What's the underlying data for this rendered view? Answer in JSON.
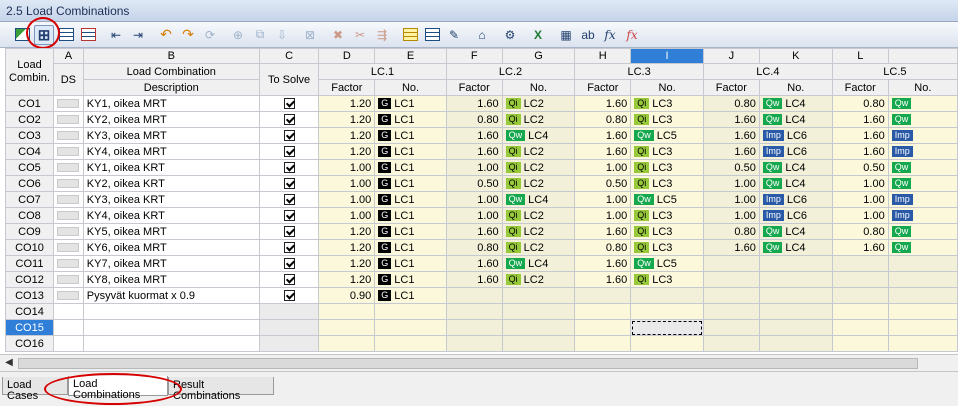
{
  "window": {
    "title": "2.5 Load Combinations"
  },
  "colletters": [
    "A",
    "B",
    "C",
    "D",
    "E",
    "F",
    "G",
    "H",
    "I",
    "J",
    "K",
    "L"
  ],
  "headers": {
    "load_combin_1": "Load",
    "load_combin_2": "Combin.",
    "ds": "DS",
    "lc_label": "Load Combination",
    "description": "Description",
    "to_solve": "To Solve",
    "factor": "Factor",
    "no": "No.",
    "groups": [
      "LC.1",
      "LC.2",
      "LC.3",
      "LC.4",
      "LC.5"
    ]
  },
  "rows": [
    {
      "id": "CO1",
      "desc": "KY1, oikea MRT",
      "solve": true,
      "lc": [
        {
          "f": "1.20",
          "t": "G",
          "n": "LC1"
        },
        {
          "f": "1.60",
          "t": "Qi",
          "n": "LC2"
        },
        {
          "f": "1.60",
          "t": "Qi",
          "n": "LC3"
        },
        {
          "f": "0.80",
          "t": "Qw",
          "n": "LC4"
        },
        {
          "f": "0.80",
          "t": "Qw",
          "n": ""
        }
      ]
    },
    {
      "id": "CO2",
      "desc": "KY2, oikea MRT",
      "solve": true,
      "lc": [
        {
          "f": "1.20",
          "t": "G",
          "n": "LC1"
        },
        {
          "f": "0.80",
          "t": "Qi",
          "n": "LC2"
        },
        {
          "f": "0.80",
          "t": "Qi",
          "n": "LC3"
        },
        {
          "f": "1.60",
          "t": "Qw",
          "n": "LC4"
        },
        {
          "f": "1.60",
          "t": "Qw",
          "n": ""
        }
      ]
    },
    {
      "id": "CO3",
      "desc": "KY3, oikea MRT",
      "solve": true,
      "lc": [
        {
          "f": "1.20",
          "t": "G",
          "n": "LC1"
        },
        {
          "f": "1.60",
          "t": "Qw",
          "n": "LC4"
        },
        {
          "f": "1.60",
          "t": "Qw",
          "n": "LC5"
        },
        {
          "f": "1.60",
          "t": "Imp",
          "n": "LC6"
        },
        {
          "f": "1.60",
          "t": "Imp",
          "n": ""
        }
      ]
    },
    {
      "id": "CO4",
      "desc": "KY4, oikea MRT",
      "solve": true,
      "lc": [
        {
          "f": "1.20",
          "t": "G",
          "n": "LC1"
        },
        {
          "f": "1.60",
          "t": "Qi",
          "n": "LC2"
        },
        {
          "f": "1.60",
          "t": "Qi",
          "n": "LC3"
        },
        {
          "f": "1.60",
          "t": "Imp",
          "n": "LC6"
        },
        {
          "f": "1.60",
          "t": "Imp",
          "n": ""
        }
      ]
    },
    {
      "id": "CO5",
      "desc": "KY1, oikea KRT",
      "solve": true,
      "lc": [
        {
          "f": "1.00",
          "t": "G",
          "n": "LC1"
        },
        {
          "f": "1.00",
          "t": "Qi",
          "n": "LC2"
        },
        {
          "f": "1.00",
          "t": "Qi",
          "n": "LC3"
        },
        {
          "f": "0.50",
          "t": "Qw",
          "n": "LC4"
        },
        {
          "f": "0.50",
          "t": "Qw",
          "n": ""
        }
      ]
    },
    {
      "id": "CO6",
      "desc": "KY2, oikea KRT",
      "solve": true,
      "lc": [
        {
          "f": "1.00",
          "t": "G",
          "n": "LC1"
        },
        {
          "f": "0.50",
          "t": "Qi",
          "n": "LC2"
        },
        {
          "f": "0.50",
          "t": "Qi",
          "n": "LC3"
        },
        {
          "f": "1.00",
          "t": "Qw",
          "n": "LC4"
        },
        {
          "f": "1.00",
          "t": "Qw",
          "n": ""
        }
      ]
    },
    {
      "id": "CO7",
      "desc": "KY3, oikea KRT",
      "solve": true,
      "lc": [
        {
          "f": "1.00",
          "t": "G",
          "n": "LC1"
        },
        {
          "f": "1.00",
          "t": "Qw",
          "n": "LC4"
        },
        {
          "f": "1.00",
          "t": "Qw",
          "n": "LC5"
        },
        {
          "f": "1.00",
          "t": "Imp",
          "n": "LC6"
        },
        {
          "f": "1.00",
          "t": "Imp",
          "n": ""
        }
      ]
    },
    {
      "id": "CO8",
      "desc": "KY4, oikea KRT",
      "solve": true,
      "lc": [
        {
          "f": "1.00",
          "t": "G",
          "n": "LC1"
        },
        {
          "f": "1.00",
          "t": "Qi",
          "n": "LC2"
        },
        {
          "f": "1.00",
          "t": "Qi",
          "n": "LC3"
        },
        {
          "f": "1.00",
          "t": "Imp",
          "n": "LC6"
        },
        {
          "f": "1.00",
          "t": "Imp",
          "n": ""
        }
      ]
    },
    {
      "id": "CO9",
      "desc": "KY5, oikea MRT",
      "solve": true,
      "lc": [
        {
          "f": "1.20",
          "t": "G",
          "n": "LC1"
        },
        {
          "f": "1.60",
          "t": "Qi",
          "n": "LC2"
        },
        {
          "f": "1.60",
          "t": "Qi",
          "n": "LC3"
        },
        {
          "f": "0.80",
          "t": "Qw",
          "n": "LC4"
        },
        {
          "f": "0.80",
          "t": "Qw",
          "n": ""
        }
      ]
    },
    {
      "id": "CO10",
      "desc": "KY6, oikea MRT",
      "solve": true,
      "lc": [
        {
          "f": "1.20",
          "t": "G",
          "n": "LC1"
        },
        {
          "f": "0.80",
          "t": "Qi",
          "n": "LC2"
        },
        {
          "f": "0.80",
          "t": "Qi",
          "n": "LC3"
        },
        {
          "f": "1.60",
          "t": "Qw",
          "n": "LC4"
        },
        {
          "f": "1.60",
          "t": "Qw",
          "n": ""
        }
      ]
    },
    {
      "id": "CO11",
      "desc": "KY7, oikea MRT",
      "solve": true,
      "lc": [
        {
          "f": "1.20",
          "t": "G",
          "n": "LC1"
        },
        {
          "f": "1.60",
          "t": "Qw",
          "n": "LC4"
        },
        {
          "f": "1.60",
          "t": "Qw",
          "n": "LC5"
        }
      ]
    },
    {
      "id": "CO12",
      "desc": "KY8, oikea MRT",
      "solve": true,
      "lc": [
        {
          "f": "1.20",
          "t": "G",
          "n": "LC1"
        },
        {
          "f": "1.60",
          "t": "Qi",
          "n": "LC2"
        },
        {
          "f": "1.60",
          "t": "Qi",
          "n": "LC3"
        }
      ]
    },
    {
      "id": "CO13",
      "desc": "Pysyvät kuormat x 0.9",
      "solve": true,
      "lc": [
        {
          "f": "0.90",
          "t": "G",
          "n": "LC1"
        }
      ]
    },
    {
      "id": "CO14",
      "desc": "",
      "solve": false,
      "lc": []
    },
    {
      "id": "CO15",
      "desc": "",
      "solve": false,
      "lc": []
    },
    {
      "id": "CO16",
      "desc": "",
      "solve": false,
      "lc": []
    }
  ],
  "tabs": [
    "Load Cases",
    "Load Combinations",
    "Result Combinations"
  ]
}
